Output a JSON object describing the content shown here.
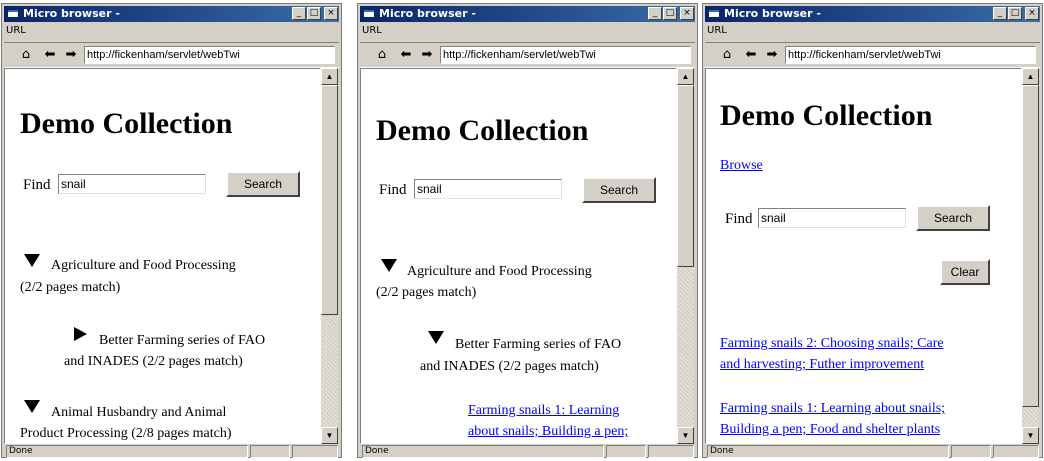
{
  "windows": [
    {
      "title": "Micro browser -",
      "menu": "URL",
      "url": "http://fickenham/servlet/webTwi",
      "status": "Done",
      "heading": "Demo Collection",
      "find_label": "Find",
      "search_value": "snail",
      "search_label": "Search",
      "items": [
        {
          "lines": [
            "Agriculture and Food Processing",
            "(2/2 pages match)"
          ]
        },
        {
          "lines": [
            "Better Farming series of FAO",
            "and INADES (2/2 pages match)"
          ]
        },
        {
          "lines": [
            "Animal Husbandry and Animal",
            "Product Processing (2/8 pages match)"
          ]
        }
      ]
    },
    {
      "title": "Micro browser -",
      "menu": "URL",
      "url": "http://fickenham/servlet/webTwi",
      "status": "Done",
      "heading": "Demo Collection",
      "find_label": "Find",
      "search_value": "snail",
      "search_label": "Search",
      "items": [
        {
          "lines": [
            "Agriculture and Food Processing",
            "(2/2 pages match)"
          ]
        },
        {
          "lines": [
            "Better Farming series of FAO",
            "and INADES (2/2 pages match)"
          ]
        }
      ],
      "links": [
        {
          "lines": [
            "Farming snails 1: Learning",
            "about snails; Building a pen;"
          ]
        }
      ]
    },
    {
      "title": "Micro browser -",
      "menu": "URL",
      "url": "http://fickenham/servlet/webTwi",
      "status": "Done",
      "heading": "Demo Collection",
      "browse_label": "Browse",
      "find_label": "Find",
      "search_value": "snail",
      "search_label": "Search",
      "clear_label": "Clear",
      "links": [
        {
          "lines": [
            "Farming snails 2: Choosing snails; Care",
            "and harvesting; Futher improvement"
          ]
        },
        {
          "lines": [
            "Farming snails 1: Learning about snails;",
            "Building a pen; Food and shelter plants"
          ]
        }
      ]
    }
  ]
}
